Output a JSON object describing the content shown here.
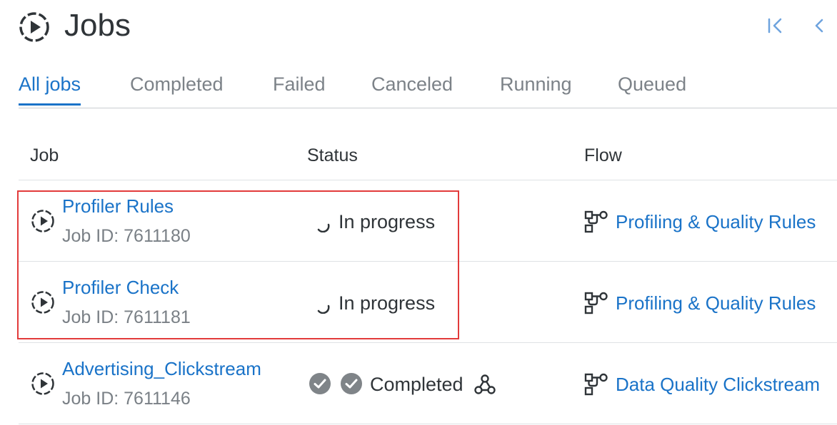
{
  "header": {
    "title": "Jobs",
    "title_icon": "play-circle-dashed-icon",
    "first_page_icon": "first-page-icon",
    "prev_page_icon": "chevron-left-icon"
  },
  "tabs": [
    {
      "label": "All jobs",
      "active": true
    },
    {
      "label": "Completed",
      "active": false
    },
    {
      "label": "Failed",
      "active": false
    },
    {
      "label": "Canceled",
      "active": false
    },
    {
      "label": "Running",
      "active": false
    },
    {
      "label": "Queued",
      "active": false
    }
  ],
  "table": {
    "columns": [
      "Job",
      "Status",
      "Flow"
    ],
    "rows": [
      {
        "name": "Profiler Rules",
        "job_id": "Job ID: 7611180",
        "status": "In progress",
        "status_icon": "spinner-icon",
        "flow": "Profiling & Quality Rules",
        "highlighted": true
      },
      {
        "name": "Profiler Check",
        "job_id": "Job ID: 7611181",
        "status": "In progress",
        "status_icon": "spinner-icon",
        "flow": "Profiling & Quality Rules",
        "highlighted": true
      },
      {
        "name": "Advertising_Clickstream",
        "job_id": "Job ID: 7611146",
        "status": "Completed",
        "status_icon": "check-circle-icon",
        "flow": "Data Quality Clickstream",
        "highlighted": false
      }
    ]
  },
  "colors": {
    "accent": "#1a73c8",
    "text": "#2f3438",
    "muted": "#7a8086",
    "highlight_border": "#e23b3b",
    "check_badge": "#7f8488"
  }
}
